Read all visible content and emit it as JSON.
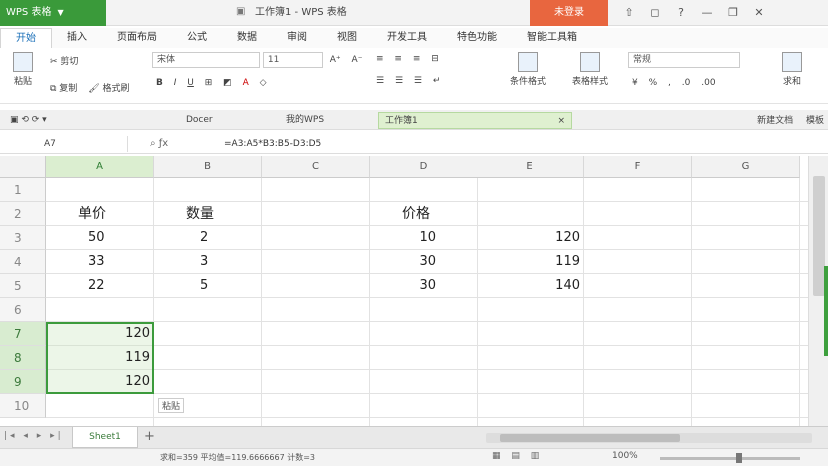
{
  "titlebar": {
    "app_label": "WPS 表格",
    "doc_title": "工作簿1 - WPS 表格",
    "login_label": "未登录",
    "controls": [
      "⇧",
      "◻",
      "?",
      "—",
      "❐",
      "✕"
    ]
  },
  "ribbon": {
    "tabs": [
      "开始",
      "插入",
      "页面布局",
      "公式",
      "数据",
      "审阅",
      "视图",
      "开发工具",
      "特色功能",
      "智能工具箱"
    ],
    "active_index": 0
  },
  "toolbar": {
    "paste_label": "粘贴",
    "cut_label": "剪切",
    "copy_label": "复制",
    "format_painter_label": "格式刷",
    "font_name": "宋体",
    "font_size": "11",
    "conditional_label": "条件格式",
    "table_style_label": "表格样式",
    "format_combo": "常规",
    "sum_label": "求和"
  },
  "docbar": {
    "tabs": [
      "Docer",
      "我的WPS",
      "工作簿1"
    ],
    "active_index": 2,
    "right_items": [
      "新建文档",
      "模板"
    ]
  },
  "formula_bar": {
    "name_box": "A7",
    "formula": "=A3:A5*B3:B5-D3:D5"
  },
  "grid": {
    "columns": [
      "A",
      "B",
      "C",
      "D",
      "E",
      "F",
      "G"
    ],
    "selected_col": "A",
    "rows": [
      "1",
      "2",
      "3",
      "4",
      "5",
      "6",
      "7",
      "8",
      "9",
      "10"
    ],
    "selected_rows": [
      "7",
      "8",
      "9"
    ],
    "cells": {
      "A2": "单价",
      "B2": "数量",
      "D2": "价格",
      "A3": "50",
      "B3": "2",
      "D3": "10",
      "E3": "120",
      "A4": "33",
      "B4": "3",
      "D4": "30",
      "E4": "119",
      "A5": "22",
      "B5": "5",
      "D5": "30",
      "E5": "140",
      "A7": "120",
      "A8": "119",
      "A9": "120"
    },
    "paste_tag": "粘贴"
  },
  "sheets": {
    "tabs": [
      "Sheet1"
    ],
    "add_label": "+"
  },
  "status": {
    "text": "求和=359 平均值=119.6666667 计数=3",
    "zoom": "100%"
  }
}
